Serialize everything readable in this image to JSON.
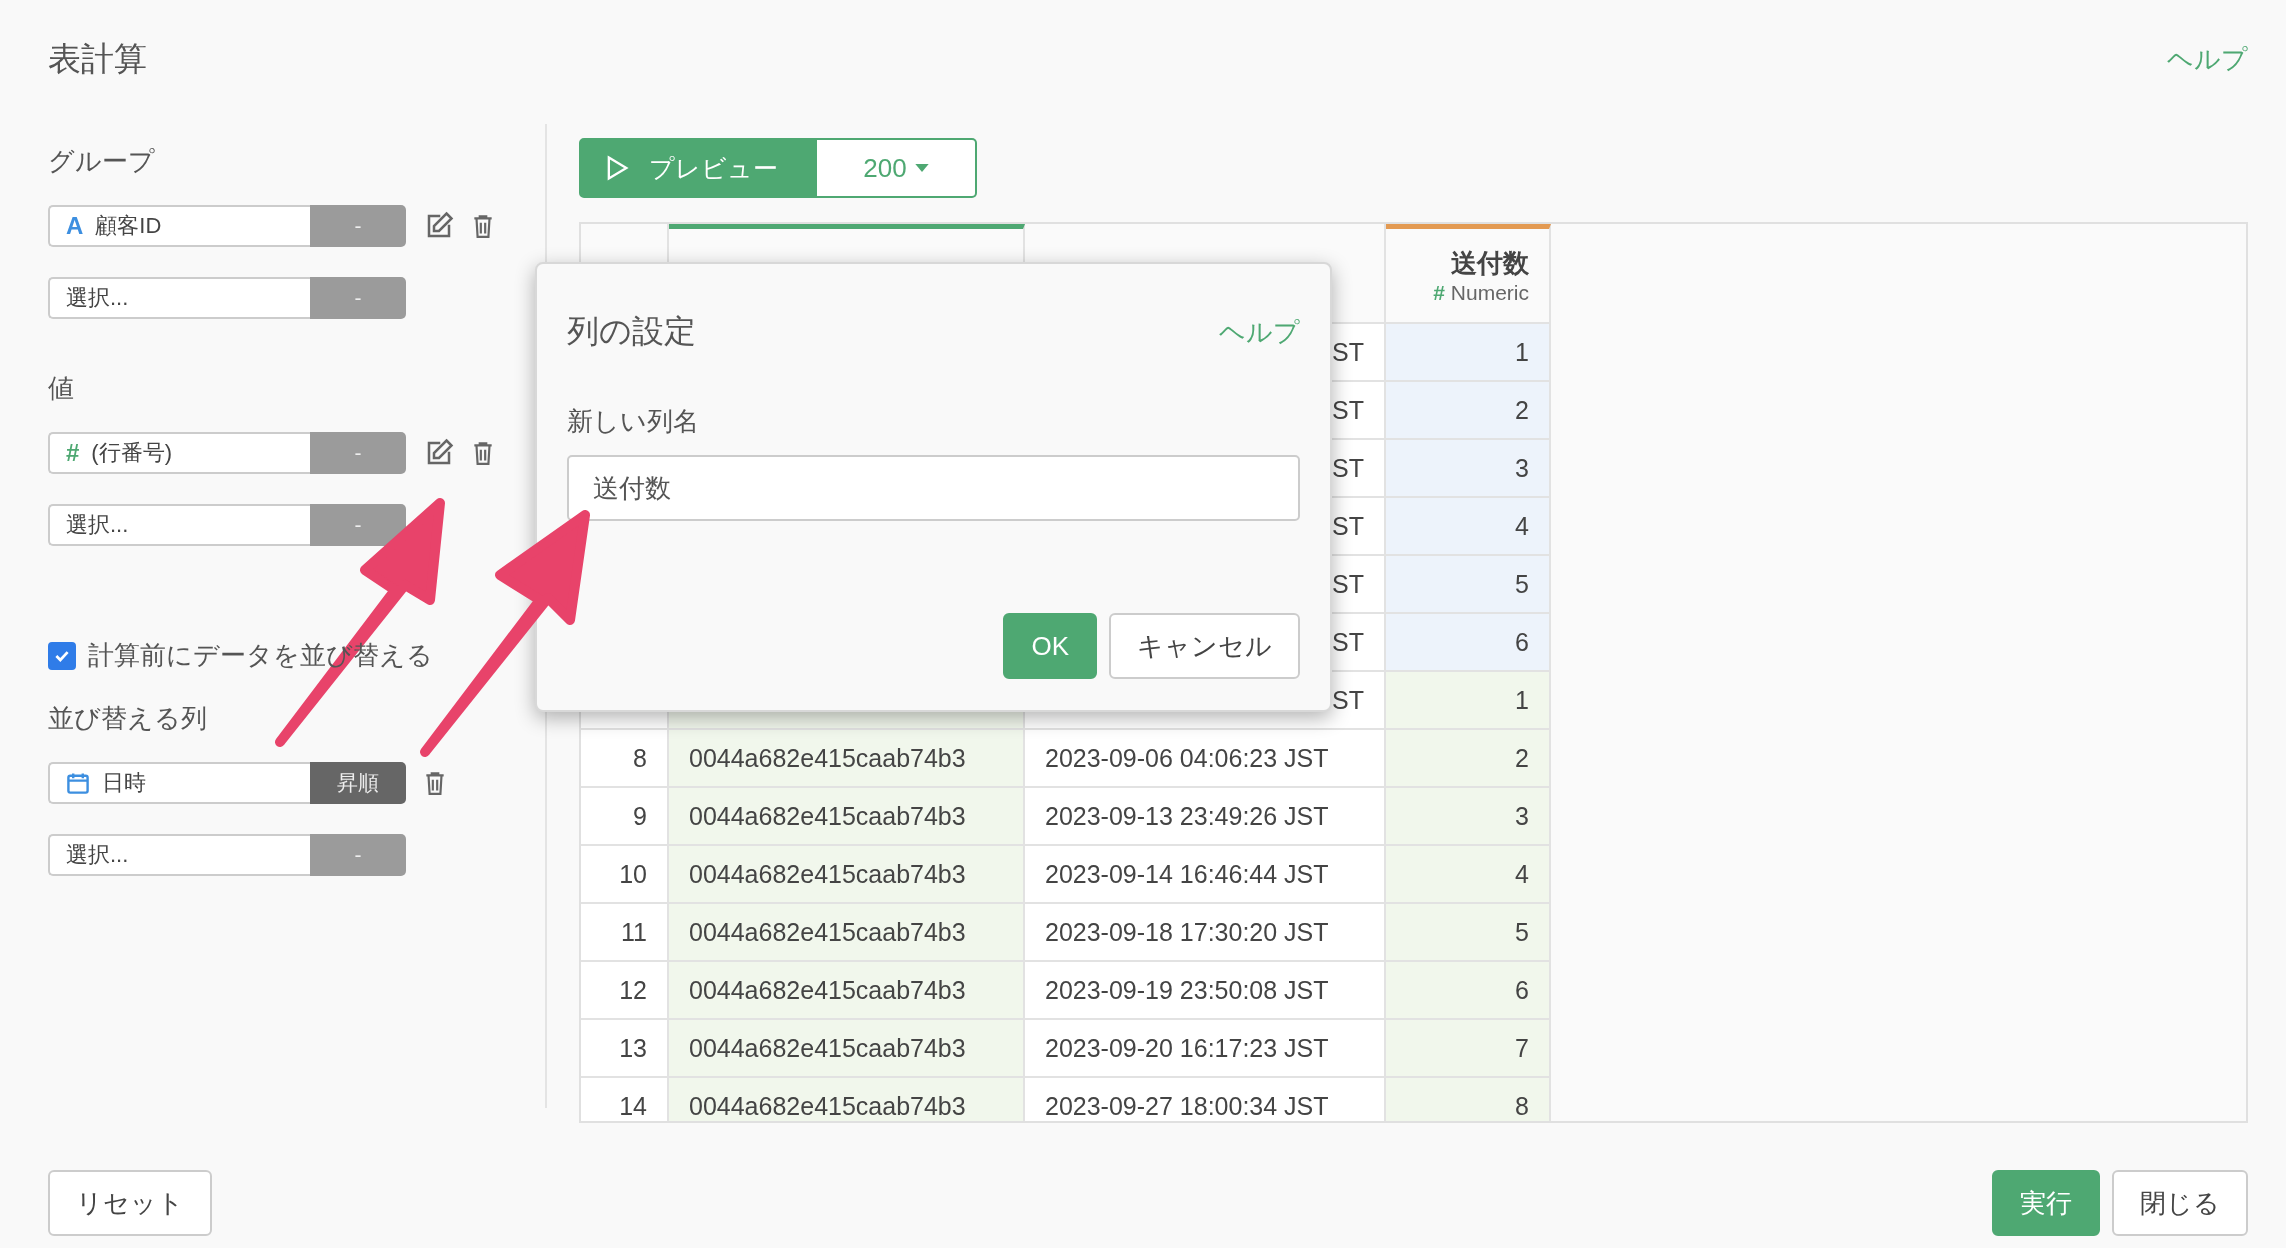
{
  "title": "表計算",
  "help": "ヘルプ",
  "sidebar": {
    "sections": [
      {
        "heading": "グループ",
        "items": [
          {
            "kind": "string",
            "icon": "A",
            "label": "顧客ID",
            "order": "-",
            "active": false,
            "edit": true,
            "delete": true
          },
          {
            "kind": "empty",
            "label": "選択...",
            "order": "-",
            "active": false,
            "edit": false,
            "delete": false
          }
        ]
      },
      {
        "heading": "値",
        "items": [
          {
            "kind": "number",
            "icon": "#",
            "label": "(行番号)",
            "order": "-",
            "active": false,
            "edit": true,
            "delete": true
          },
          {
            "kind": "empty",
            "label": "選択...",
            "order": "-",
            "active": false,
            "edit": false,
            "delete": false
          }
        ]
      }
    ],
    "sort_checkbox": {
      "label": "計算前にデータを並び替える",
      "checked": true
    },
    "sort": {
      "heading": "並び替える列",
      "items": [
        {
          "kind": "date",
          "label": "日時",
          "order": "昇順",
          "active": true,
          "edit": false,
          "delete": true
        },
        {
          "kind": "empty",
          "label": "選択...",
          "order": "-",
          "active": false,
          "edit": false,
          "delete": false
        }
      ]
    }
  },
  "preview": {
    "label": "プレビュー",
    "count": "200"
  },
  "table": {
    "id_column": {
      "color": "#4ea872"
    },
    "value_column": {
      "label": "送付数",
      "type_icon": "#",
      "type": "Numeric",
      "color": "#e39a52"
    },
    "rows": [
      {
        "datetime": "ST",
        "value": "1",
        "color": "#edf3fb"
      },
      {
        "datetime": "ST",
        "value": "2",
        "color": "#edf3fb"
      },
      {
        "datetime": "ST",
        "value": "3",
        "color": "#edf3fb"
      },
      {
        "datetime": "ST",
        "value": "4",
        "color": "#edf3fb"
      },
      {
        "datetime": "ST",
        "value": "5",
        "color": "#edf3fb"
      },
      {
        "datetime": "ST",
        "value": "6",
        "color": "#edf3fb"
      },
      {
        "datetime": "ST",
        "value": "1",
        "color": "#f1f7ec"
      },
      {
        "number": "8",
        "customer_id": "0044a682e415caab74b3",
        "datetime": "2023-09-06 04:06:23 JST",
        "value": "2",
        "color": "#f1f7ec"
      },
      {
        "number": "9",
        "customer_id": "0044a682e415caab74b3",
        "datetime": "2023-09-13 23:49:26 JST",
        "value": "3",
        "color": "#f1f7ec"
      },
      {
        "number": "10",
        "customer_id": "0044a682e415caab74b3",
        "datetime": "2023-09-14 16:46:44 JST",
        "value": "4",
        "color": "#f1f7ec"
      },
      {
        "number": "11",
        "customer_id": "0044a682e415caab74b3",
        "datetime": "2023-09-18 17:30:20 JST",
        "value": "5",
        "color": "#f1f7ec"
      },
      {
        "number": "12",
        "customer_id": "0044a682e415caab74b3",
        "datetime": "2023-09-19 23:50:08 JST",
        "value": "6",
        "color": "#f1f7ec"
      },
      {
        "number": "13",
        "customer_id": "0044a682e415caab74b3",
        "datetime": "2023-09-20 16:17:23 JST",
        "value": "7",
        "color": "#f1f7ec"
      },
      {
        "number": "14",
        "customer_id": "0044a682e415caab74b3",
        "datetime": "2023-09-27 18:00:34 JST",
        "value": "8",
        "color": "#f1f7ec"
      }
    ]
  },
  "dialog": {
    "title": "列の設定",
    "help": "ヘルプ",
    "field_label": "新しい列名",
    "value": "送付数",
    "ok": "OK",
    "cancel": "キャンセル"
  },
  "footer": {
    "reset": "リセット",
    "run": "実行",
    "close": "閉じる"
  }
}
